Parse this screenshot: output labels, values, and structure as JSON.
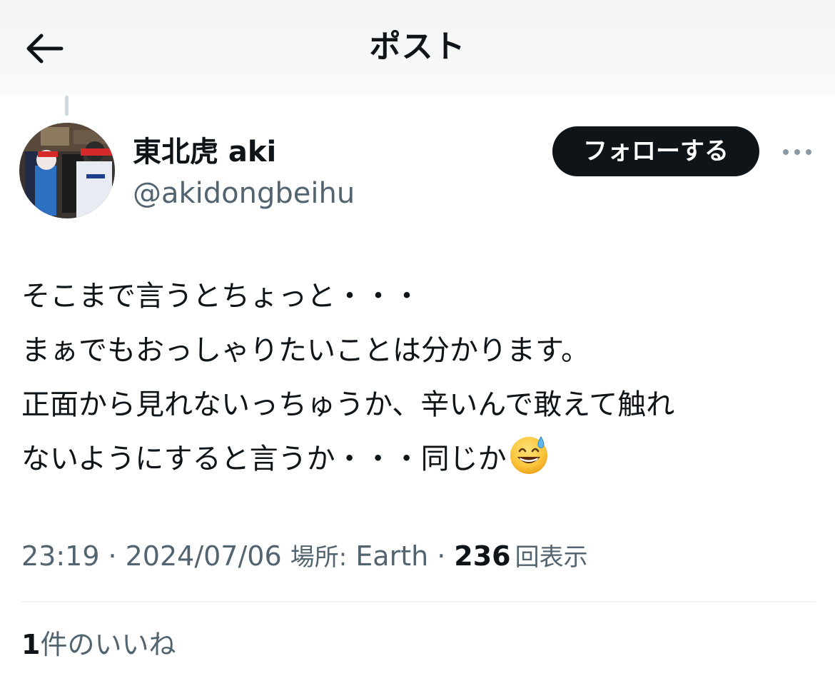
{
  "header": {
    "title": "ポスト",
    "back_icon": "arrow-left-icon"
  },
  "author": {
    "display_name": "東北虎 aki",
    "handle": "@akidongbeihu",
    "follow_label": "フォローする",
    "more_icon": "more-horizontal-icon"
  },
  "post": {
    "lines": [
      "そこまで言うとちょっと・・・",
      "まぁでもおっしゃりたいことは分かります。",
      "正面から見れないっちゅうか、辛いんで敢えて触れ",
      "ないようにすると言うか・・・同じか"
    ],
    "emoji": "grinning-face-with-sweat-emoji"
  },
  "meta": {
    "time": "23:19",
    "separator": "·",
    "date": "2024/07/06",
    "location_label": "場所:",
    "location": "Earth",
    "views_count": "236",
    "views_label": "回表示"
  },
  "likes": {
    "count": "1",
    "label": "件のいいね"
  },
  "colors": {
    "text_primary": "#0f1419",
    "text_secondary": "#536471",
    "follow_button_bg": "#0f1419",
    "follow_button_text": "#ffffff",
    "divider": "#eff3f4"
  }
}
